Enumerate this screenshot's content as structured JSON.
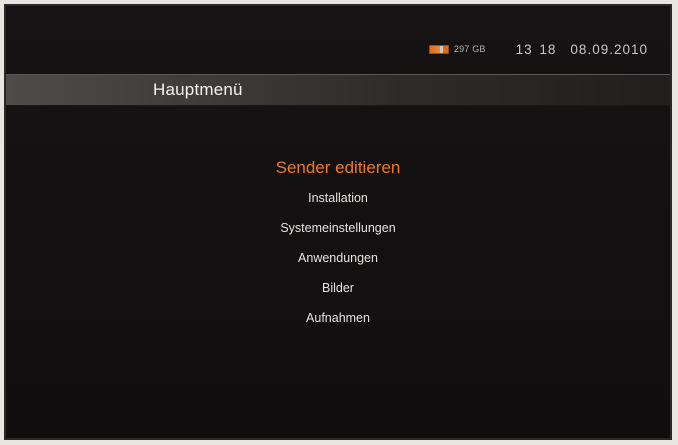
{
  "status": {
    "disk_icon": "hard-disk-icon",
    "disk_size": "297 GB",
    "time": "13 18",
    "date": "08.09.2010"
  },
  "header": {
    "title": "Hauptmenü"
  },
  "menu": {
    "items": [
      {
        "label": "Sender editieren",
        "selected": true
      },
      {
        "label": "Installation",
        "selected": false
      },
      {
        "label": "Systemeinstellungen",
        "selected": false
      },
      {
        "label": "Anwendungen",
        "selected": false
      },
      {
        "label": "Bilder",
        "selected": false
      },
      {
        "label": "Aufnahmen",
        "selected": false
      }
    ]
  },
  "colors": {
    "highlight": "#f07a1e",
    "text": "#e6e4df",
    "background": "#131111"
  }
}
